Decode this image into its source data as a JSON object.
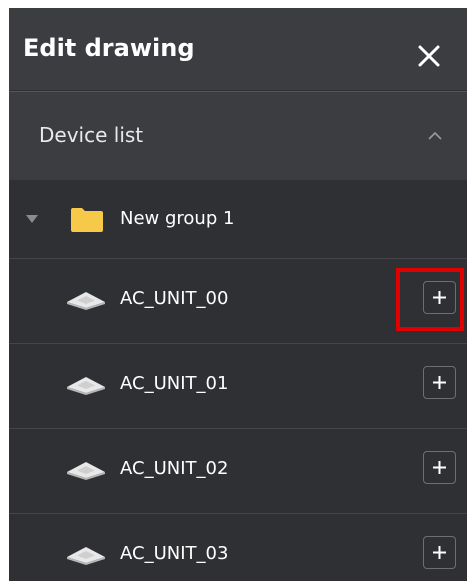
{
  "header": {
    "title": "Edit drawing",
    "close_icon": "close-icon"
  },
  "section": {
    "title": "Device list",
    "collapse_icon": "chevron-up-icon"
  },
  "group": {
    "label": "New group 1",
    "icon": "folder-icon",
    "folder_color": "#f7c948"
  },
  "devices": [
    {
      "label": "AC_UNIT_00",
      "icon": "ceiling-cassette-ac-icon",
      "add_label": "+"
    },
    {
      "label": "AC_UNIT_01",
      "icon": "ceiling-cassette-ac-icon",
      "add_label": "+"
    },
    {
      "label": "AC_UNIT_02",
      "icon": "ceiling-cassette-ac-icon",
      "add_label": "+"
    },
    {
      "label": "AC_UNIT_03",
      "icon": "ceiling-cassette-ac-icon",
      "add_label": "+"
    }
  ],
  "colors": {
    "panel": "#2f3034",
    "header": "#3c3d41",
    "highlight": "#e00000"
  }
}
